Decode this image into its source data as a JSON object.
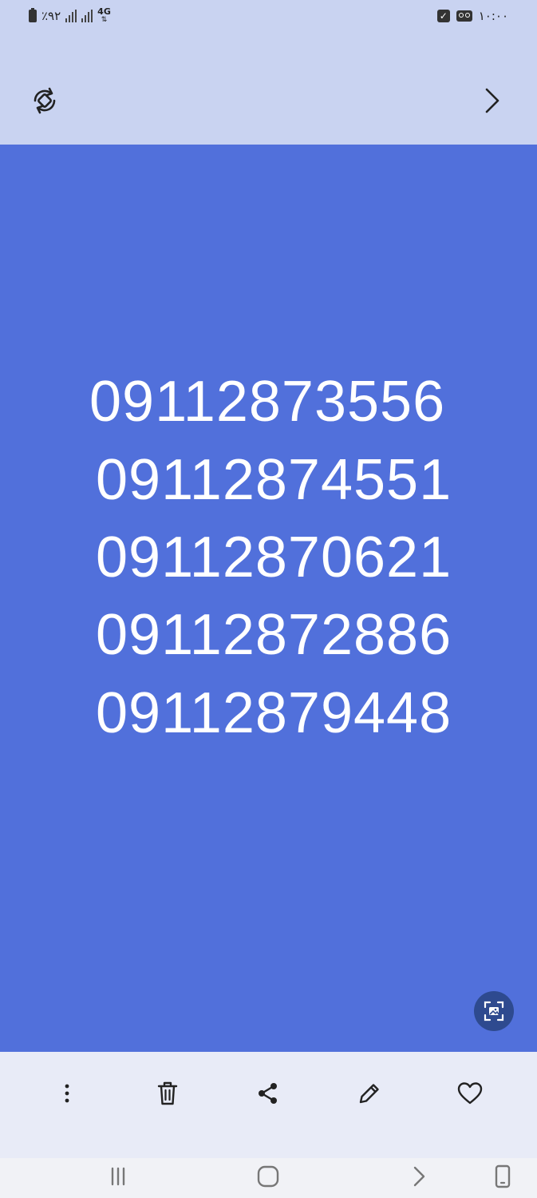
{
  "status_bar": {
    "battery_text": "٪۹۲",
    "network_type": "4G",
    "time": "۱۰:۰۰"
  },
  "image": {
    "background_color": "#5170db",
    "phone_numbers": [
      "09112873556",
      "09112874551",
      "09112870621",
      "09112872886",
      "09112879448"
    ]
  },
  "icons": {
    "rotate": "rotate-icon",
    "next": "chevron-right-icon",
    "scan": "image-scan-icon",
    "more": "more-vertical-icon",
    "delete": "trash-icon",
    "share": "share-icon",
    "edit": "pencil-icon",
    "favorite": "heart-icon",
    "recents": "recents-icon",
    "home": "home-icon",
    "back": "back-icon",
    "rotate_screen": "rotate-screen-icon"
  }
}
